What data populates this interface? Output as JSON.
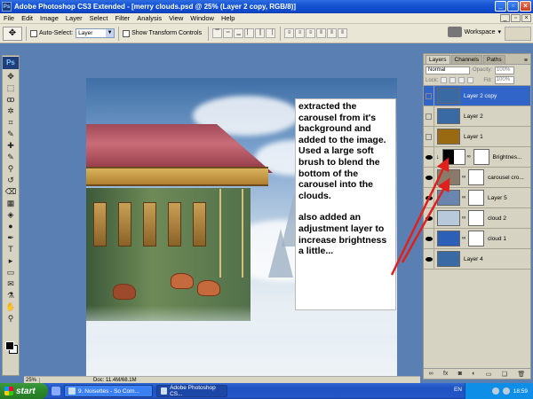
{
  "window": {
    "title": "Adobe Photoshop CS3 Extended - [merry clouds.psd @ 25% (Layer 2 copy, RGB/8)]",
    "app_icon": "Ps"
  },
  "menu": [
    "File",
    "Edit",
    "Image",
    "Layer",
    "Select",
    "Filter",
    "Analysis",
    "View",
    "Window",
    "Help"
  ],
  "options": {
    "auto_select_label": "Auto-Select:",
    "auto_select_value": "Layer",
    "show_transform_label": "Show Transform Controls",
    "workspace_label": "Workspace"
  },
  "toolbox": {
    "logo": "Ps",
    "icons": [
      "move-icon",
      "marquee-icon",
      "lasso-icon",
      "magic-wand-icon",
      "crop-icon",
      "slice-icon",
      "healing-icon",
      "brush-icon",
      "clone-stamp-icon",
      "history-brush-icon",
      "eraser-icon",
      "gradient-icon",
      "blur-icon",
      "dodge-icon",
      "pen-icon",
      "type-icon",
      "path-select-icon",
      "shape-icon",
      "notes-icon",
      "eyedropper-icon",
      "hand-icon",
      "zoom-icon"
    ],
    "glyphs": [
      "✥",
      "⬚",
      "ꝏ",
      "✲",
      "⌗",
      "✎",
      "✚",
      "✎",
      "⚲",
      "↺",
      "⌫",
      "▦",
      "◈",
      "●",
      "✒",
      "T",
      "▸",
      "▭",
      "✉",
      "⚗",
      "✋",
      "⚲"
    ]
  },
  "note": {
    "paragraph1": "extracted the carousel from it's background and added to the image. Used a large soft brush to blend the bottom of the carousel into the clouds.",
    "paragraph2": "also added an adjustment layer to increase brightness a little..."
  },
  "status": {
    "zoom": "25%",
    "doc": "Doc: 11.4M/68.1M"
  },
  "layers_panel": {
    "tabs": [
      "Layers",
      "Channels",
      "Paths"
    ],
    "blend_mode": "Normal",
    "opacity_label": "Opacity:",
    "opacity_value": "100%",
    "lock_label": "Lock:",
    "fill_label": "Fill:",
    "fill_value": "100%",
    "layers": [
      {
        "name": "Layer 2 copy",
        "visible": false,
        "selected": true,
        "thumb_color": "#3a6aa3",
        "has_mask": false
      },
      {
        "name": "Layer 2",
        "visible": false,
        "selected": false,
        "thumb_color": "#3a6aa3",
        "has_mask": false
      },
      {
        "name": "Layer 1",
        "visible": false,
        "selected": false,
        "thumb_color": "#9a6a12",
        "has_mask": false
      },
      {
        "name": "Brightnes...",
        "visible": true,
        "selected": false,
        "thumb_color": "#ffffff",
        "has_mask": true,
        "adjustment": true
      },
      {
        "name": "carousel cro...",
        "visible": true,
        "selected": false,
        "thumb_color": "#8a7a6a",
        "has_mask": true
      },
      {
        "name": "Layer 5",
        "visible": true,
        "selected": false,
        "thumb_color": "#6a86b0",
        "has_mask": true
      },
      {
        "name": "cloud 2",
        "visible": true,
        "selected": false,
        "thumb_color": "#b9c9dc",
        "has_mask": true
      },
      {
        "name": "cloud 1",
        "visible": true,
        "selected": false,
        "thumb_color": "#2c5fb8",
        "has_mask": true
      },
      {
        "name": "Layer 4",
        "visible": true,
        "selected": false,
        "thumb_color": "#3a6aa3",
        "has_mask": false
      }
    ],
    "footer_icons": [
      "link-icon",
      "fx-icon",
      "mask-icon",
      "adjustment-icon",
      "group-icon",
      "new-layer-icon",
      "trash-icon"
    ],
    "footer_glyphs": [
      "∞",
      "fx",
      "◙",
      "◐",
      "▭",
      "❏",
      "🗑"
    ]
  },
  "taskbar": {
    "start_label": "start",
    "tasks": [
      "9. Noisettes - So Com...",
      "Adobe Photoshop CS..."
    ],
    "language": "EN",
    "clock": "18:59"
  },
  "colors": {
    "accent": "#3165c8",
    "arrow": "#e0201c",
    "workspace_bg": "#5a7fb3"
  }
}
